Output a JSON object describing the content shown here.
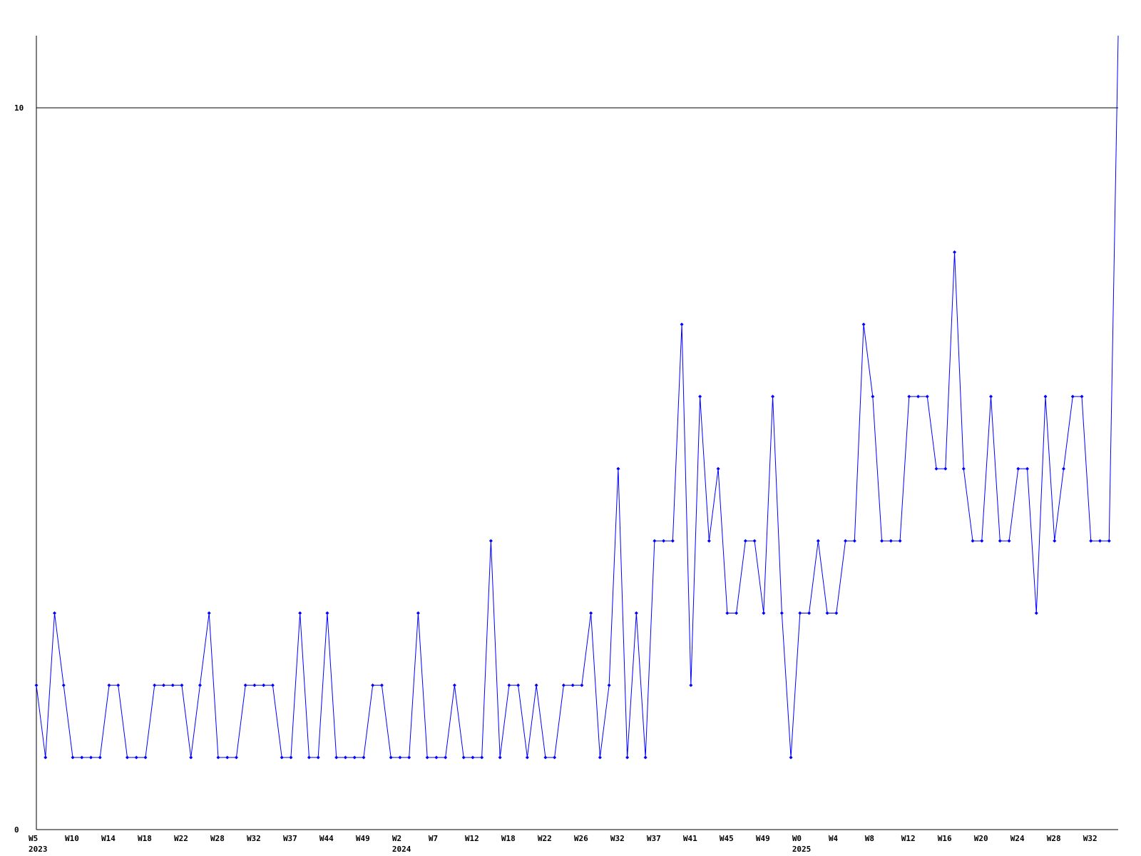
{
  "chart_data": {
    "type": "line",
    "title": "",
    "xlabel": "",
    "ylabel": "",
    "ylim": [
      0,
      11
    ],
    "y_ticks": [
      {
        "value": 0,
        "label": "0"
      },
      {
        "value": 10,
        "label": "10"
      }
    ],
    "grid": "horizontal line at 10",
    "x_ticks": [
      {
        "index": 0,
        "label": "W5",
        "year": "2023"
      },
      {
        "index": 4,
        "label": "W10",
        "year": ""
      },
      {
        "index": 8,
        "label": "W14",
        "year": ""
      },
      {
        "index": 12,
        "label": "W18",
        "year": ""
      },
      {
        "index": 16,
        "label": "W22",
        "year": ""
      },
      {
        "index": 20,
        "label": "W28",
        "year": ""
      },
      {
        "index": 24,
        "label": "W32",
        "year": ""
      },
      {
        "index": 28,
        "label": "W37",
        "year": ""
      },
      {
        "index": 32,
        "label": "W44",
        "year": ""
      },
      {
        "index": 36,
        "label": "W49",
        "year": ""
      },
      {
        "index": 40,
        "label": "W2",
        "year": "2024"
      },
      {
        "index": 44,
        "label": "W7",
        "year": ""
      },
      {
        "index": 48,
        "label": "W12",
        "year": ""
      },
      {
        "index": 52,
        "label": "W18",
        "year": ""
      },
      {
        "index": 56,
        "label": "W22",
        "year": ""
      },
      {
        "index": 60,
        "label": "W26",
        "year": ""
      },
      {
        "index": 64,
        "label": "W32",
        "year": ""
      },
      {
        "index": 68,
        "label": "W37",
        "year": ""
      },
      {
        "index": 72,
        "label": "W41",
        "year": ""
      },
      {
        "index": 76,
        "label": "W45",
        "year": ""
      },
      {
        "index": 80,
        "label": "W49",
        "year": ""
      },
      {
        "index": 84,
        "label": "W0",
        "year": "2025"
      },
      {
        "index": 88,
        "label": "W4",
        "year": ""
      },
      {
        "index": 92,
        "label": "W8",
        "year": ""
      },
      {
        "index": 96,
        "label": "W12",
        "year": ""
      },
      {
        "index": 100,
        "label": "W16",
        "year": ""
      },
      {
        "index": 104,
        "label": "W20",
        "year": ""
      },
      {
        "index": 108,
        "label": "W24",
        "year": ""
      },
      {
        "index": 112,
        "label": "W28",
        "year": ""
      },
      {
        "index": 116,
        "label": "W32",
        "year": ""
      }
    ],
    "series": [
      {
        "color": "#0000ff",
        "values": [
          2,
          1,
          3,
          2,
          1,
          1,
          1,
          1,
          2,
          2,
          1,
          1,
          1,
          2,
          2,
          2,
          2,
          1,
          2,
          3,
          1,
          1,
          1,
          2,
          2,
          2,
          2,
          1,
          1,
          3,
          1,
          1,
          3,
          1,
          1,
          1,
          1,
          2,
          2,
          1,
          1,
          1,
          3,
          1,
          1,
          1,
          2,
          1,
          1,
          1,
          4,
          1,
          2,
          2,
          1,
          2,
          1,
          1,
          2,
          2,
          2,
          3,
          1,
          2,
          5,
          1,
          3,
          1,
          4,
          4,
          4,
          7,
          2,
          6,
          4,
          5,
          3,
          3,
          4,
          4,
          3,
          6,
          3,
          1,
          3,
          3,
          4,
          3,
          3,
          4,
          4,
          7,
          6,
          4,
          4,
          4,
          6,
          6,
          6,
          5,
          5,
          8,
          5,
          4,
          4,
          6,
          4,
          4,
          5,
          5,
          3,
          6,
          4,
          5,
          6,
          6,
          4,
          4,
          4,
          11
        ]
      }
    ]
  }
}
